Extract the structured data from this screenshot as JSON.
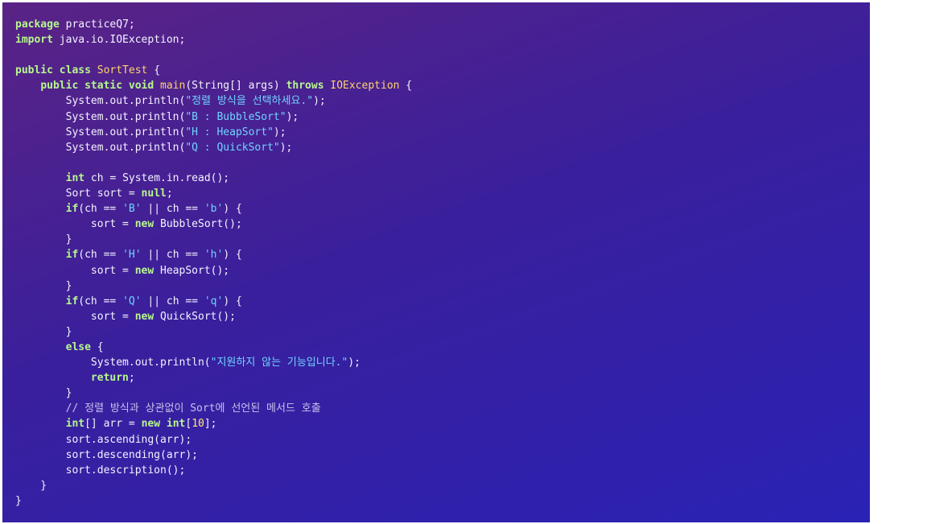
{
  "code": {
    "lines": [
      [
        {
          "t": "kw",
          "v": "package"
        },
        {
          "t": "pun",
          "v": " practiceQ7;"
        }
      ],
      [
        {
          "t": "kw",
          "v": "import"
        },
        {
          "t": "pun",
          "v": " java.io.IOException;"
        }
      ],
      [],
      [
        {
          "t": "kw",
          "v": "public class"
        },
        {
          "t": "pun",
          "v": " "
        },
        {
          "t": "type",
          "v": "SortTest"
        },
        {
          "t": "pun",
          "v": " {"
        }
      ],
      [
        {
          "t": "pun",
          "v": "    "
        },
        {
          "t": "kw",
          "v": "public static void"
        },
        {
          "t": "pun",
          "v": " "
        },
        {
          "t": "type",
          "v": "main"
        },
        {
          "t": "pun",
          "v": "(String[] args) "
        },
        {
          "t": "kw",
          "v": "throws"
        },
        {
          "t": "pun",
          "v": " "
        },
        {
          "t": "type",
          "v": "IOException"
        },
        {
          "t": "pun",
          "v": " {"
        }
      ],
      [
        {
          "t": "pun",
          "v": "        System.out.println("
        },
        {
          "t": "str",
          "v": "\"정렬 방식을 선택하세요.\""
        },
        {
          "t": "pun",
          "v": ");"
        }
      ],
      [
        {
          "t": "pun",
          "v": "        System.out.println("
        },
        {
          "t": "str",
          "v": "\"B : BubbleSort\""
        },
        {
          "t": "pun",
          "v": ");"
        }
      ],
      [
        {
          "t": "pun",
          "v": "        System.out.println("
        },
        {
          "t": "str",
          "v": "\"H : HeapSort\""
        },
        {
          "t": "pun",
          "v": ");"
        }
      ],
      [
        {
          "t": "pun",
          "v": "        System.out.println("
        },
        {
          "t": "str",
          "v": "\"Q : QuickSort\""
        },
        {
          "t": "pun",
          "v": ");"
        }
      ],
      [],
      [
        {
          "t": "pun",
          "v": "        "
        },
        {
          "t": "kw",
          "v": "int"
        },
        {
          "t": "pun",
          "v": " ch = System.in.read();"
        }
      ],
      [
        {
          "t": "pun",
          "v": "        Sort sort = "
        },
        {
          "t": "kw",
          "v": "null"
        },
        {
          "t": "pun",
          "v": ";"
        }
      ],
      [
        {
          "t": "pun",
          "v": "        "
        },
        {
          "t": "kw",
          "v": "if"
        },
        {
          "t": "pun",
          "v": "(ch == "
        },
        {
          "t": "str",
          "v": "'B'"
        },
        {
          "t": "pun",
          "v": " || ch == "
        },
        {
          "t": "str",
          "v": "'b'"
        },
        {
          "t": "pun",
          "v": ") {"
        }
      ],
      [
        {
          "t": "pun",
          "v": "            sort = "
        },
        {
          "t": "kw",
          "v": "new"
        },
        {
          "t": "pun",
          "v": " BubbleSort();"
        }
      ],
      [
        {
          "t": "pun",
          "v": "        }"
        }
      ],
      [
        {
          "t": "pun",
          "v": "        "
        },
        {
          "t": "kw",
          "v": "if"
        },
        {
          "t": "pun",
          "v": "(ch == "
        },
        {
          "t": "str",
          "v": "'H'"
        },
        {
          "t": "pun",
          "v": " || ch == "
        },
        {
          "t": "str",
          "v": "'h'"
        },
        {
          "t": "pun",
          "v": ") {"
        }
      ],
      [
        {
          "t": "pun",
          "v": "            sort = "
        },
        {
          "t": "kw",
          "v": "new"
        },
        {
          "t": "pun",
          "v": " HeapSort();"
        }
      ],
      [
        {
          "t": "pun",
          "v": "        }"
        }
      ],
      [
        {
          "t": "pun",
          "v": "        "
        },
        {
          "t": "kw",
          "v": "if"
        },
        {
          "t": "pun",
          "v": "(ch == "
        },
        {
          "t": "str",
          "v": "'Q'"
        },
        {
          "t": "pun",
          "v": " || ch == "
        },
        {
          "t": "str",
          "v": "'q'"
        },
        {
          "t": "pun",
          "v": ") {"
        }
      ],
      [
        {
          "t": "pun",
          "v": "            sort = "
        },
        {
          "t": "kw",
          "v": "new"
        },
        {
          "t": "pun",
          "v": " QuickSort();"
        }
      ],
      [
        {
          "t": "pun",
          "v": "        }"
        }
      ],
      [
        {
          "t": "pun",
          "v": "        "
        },
        {
          "t": "kw",
          "v": "else"
        },
        {
          "t": "pun",
          "v": " {"
        }
      ],
      [
        {
          "t": "pun",
          "v": "            System.out.println("
        },
        {
          "t": "str",
          "v": "\"지원하지 않는 기능입니다.\""
        },
        {
          "t": "pun",
          "v": ");"
        }
      ],
      [
        {
          "t": "pun",
          "v": "            "
        },
        {
          "t": "kw",
          "v": "return"
        },
        {
          "t": "pun",
          "v": ";"
        }
      ],
      [
        {
          "t": "pun",
          "v": "        }"
        }
      ],
      [
        {
          "t": "pun",
          "v": "        "
        },
        {
          "t": "cmt",
          "v": "// 정렬 방식과 상관없이 Sort에 선언된 메서드 호출"
        }
      ],
      [
        {
          "t": "pun",
          "v": "        "
        },
        {
          "t": "kw",
          "v": "int"
        },
        {
          "t": "pun",
          "v": "[] arr = "
        },
        {
          "t": "kw",
          "v": "new int"
        },
        {
          "t": "pun",
          "v": "["
        },
        {
          "t": "num",
          "v": "10"
        },
        {
          "t": "pun",
          "v": "];"
        }
      ],
      [
        {
          "t": "pun",
          "v": "        sort.ascending(arr);"
        }
      ],
      [
        {
          "t": "pun",
          "v": "        sort.descending(arr);"
        }
      ],
      [
        {
          "t": "pun",
          "v": "        sort.description();"
        }
      ],
      [
        {
          "t": "pun",
          "v": "    }"
        }
      ],
      [
        {
          "t": "pun",
          "v": "}"
        }
      ]
    ]
  }
}
